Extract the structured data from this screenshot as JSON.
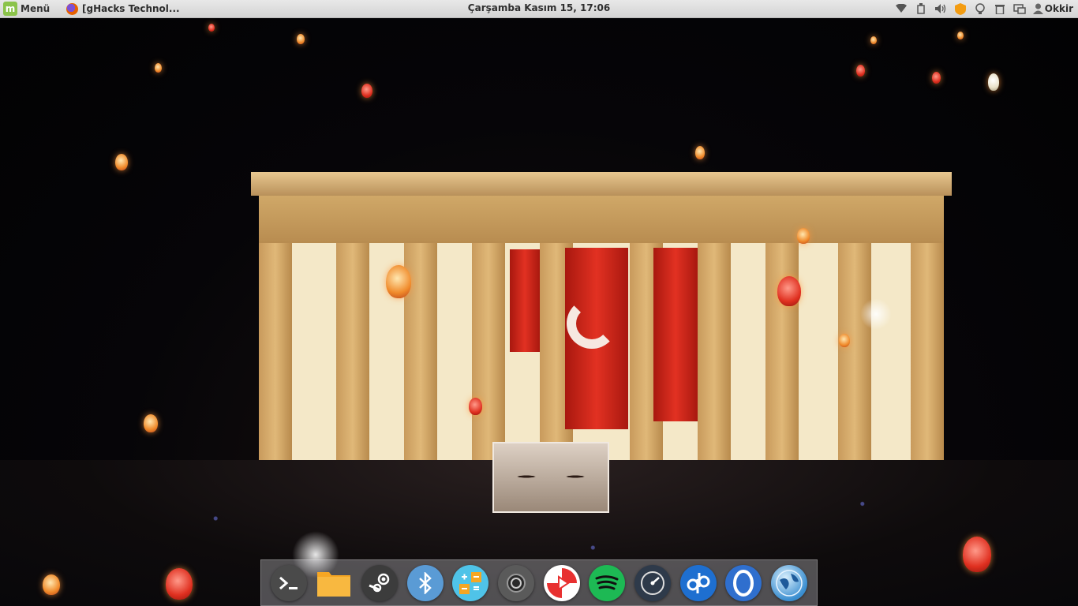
{
  "panel": {
    "menu_label": "Menü",
    "menu_icon": "linux-mint-icon",
    "window_title": "[gHacks Technol...",
    "window_icon": "firefox-icon",
    "clock": "Çarşamba Kasım 15, 17:06",
    "tray_icons": [
      "wifi-icon",
      "usb-drive-icon",
      "volume-icon",
      "update-shield-icon",
      "lightbulb-icon",
      "trash-icon",
      "display-icon"
    ],
    "user_name": "Okkir"
  },
  "dock": {
    "items": [
      {
        "name": "terminal",
        "icon": "terminal-icon",
        "color": "#4a4a4a"
      },
      {
        "name": "files",
        "icon": "folder-icon",
        "color": "#f6a623"
      },
      {
        "name": "steam",
        "icon": "steam-icon",
        "color": "#3c3c3c"
      },
      {
        "name": "bluetooth",
        "icon": "bluetooth-icon",
        "color": "#5a9bd5"
      },
      {
        "name": "calculator",
        "icon": "calculator-icon",
        "color": "#4fc3e8"
      },
      {
        "name": "webcam",
        "icon": "camera-icon",
        "color": "#5a5a5a"
      },
      {
        "name": "popcorn",
        "icon": "popcorn-icon",
        "color": "#e83030"
      },
      {
        "name": "spotify",
        "icon": "spotify-icon",
        "color": "#1db954"
      },
      {
        "name": "system-monitor",
        "icon": "speedometer-icon",
        "color": "#2e3a4a"
      },
      {
        "name": "qbittorrent",
        "icon": "qbittorrent-icon",
        "color": "#1e6fd0"
      },
      {
        "name": "opera",
        "icon": "opera-icon",
        "color": "#2f6fce"
      },
      {
        "name": "earth",
        "icon": "globe-icon",
        "color": "#3a8ed0"
      }
    ]
  },
  "wallpaper": {
    "subject": "wallpaper-image"
  }
}
